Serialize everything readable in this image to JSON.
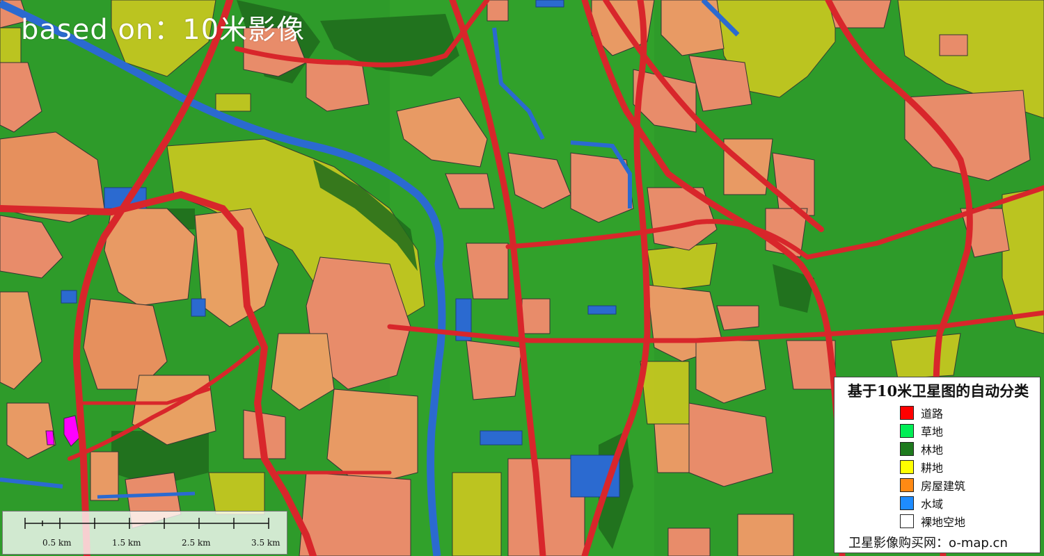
{
  "map": {
    "overlay_title": "based on：10米影像",
    "colors": {
      "background_green": "#2e9b2a",
      "road": "#d8262b",
      "water": "#2b6ad0",
      "building": "#e88c6a",
      "cropland": "#c8c820",
      "forest": "#1f6b1c",
      "bare": "#ff00ff"
    }
  },
  "legend": {
    "title": "基于10米卫星图的自动分类",
    "items": [
      {
        "label": "道路",
        "color": "#ff0000"
      },
      {
        "label": "草地",
        "color": "#00ee55"
      },
      {
        "label": "林地",
        "color": "#1e7a1e"
      },
      {
        "label": "耕地",
        "color": "#ffff00"
      },
      {
        "label": "房屋建筑",
        "color": "#ff8a14"
      },
      {
        "label": "水域",
        "color": "#1e8cff"
      },
      {
        "label": "裸地空地",
        "color": "#ffffff"
      }
    ],
    "footer": "卫星影像购买网：o-map.cn"
  },
  "scalebar": {
    "labels": [
      "0.5 km",
      "1.5 km",
      "2.5 km",
      "3.5 km"
    ]
  }
}
